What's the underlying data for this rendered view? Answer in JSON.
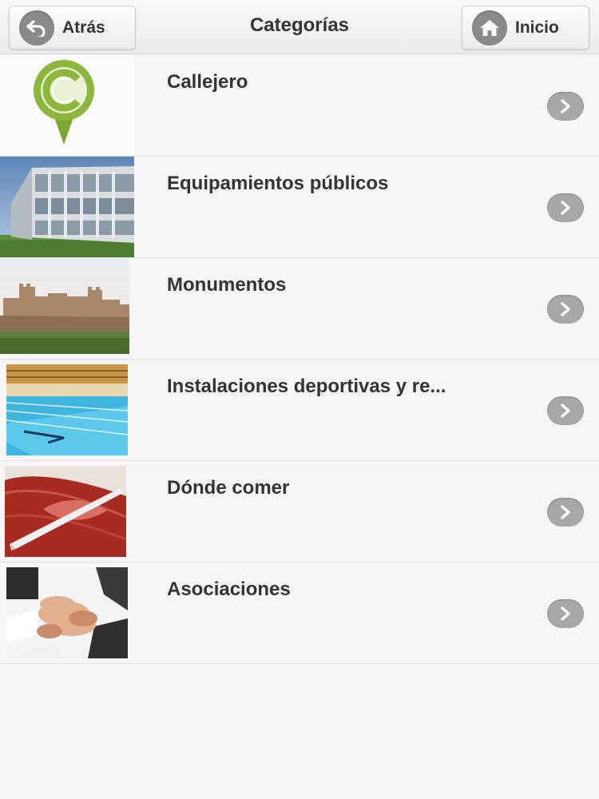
{
  "header": {
    "title": "Categorías",
    "back_label": "Atrás",
    "home_label": "Inicio"
  },
  "colors": {
    "header_bg": "#ececec",
    "row_bg": "#f6f6f6",
    "arrow_bg": "#a8a8a8",
    "callejero_green": "#8cb63c"
  },
  "categories": [
    {
      "label": "Callejero",
      "icon": "callejero-logo-icon"
    },
    {
      "label": "Equipamientos públicos",
      "icon": "public-building-photo"
    },
    {
      "label": "Monumentos",
      "icon": "castle-photo"
    },
    {
      "label": "Instalaciones deportivas y re...",
      "icon": "swimming-pool-photo"
    },
    {
      "label": "Dónde comer",
      "icon": "ham-photo"
    },
    {
      "label": "Asociaciones",
      "icon": "joined-hands-photo"
    }
  ]
}
